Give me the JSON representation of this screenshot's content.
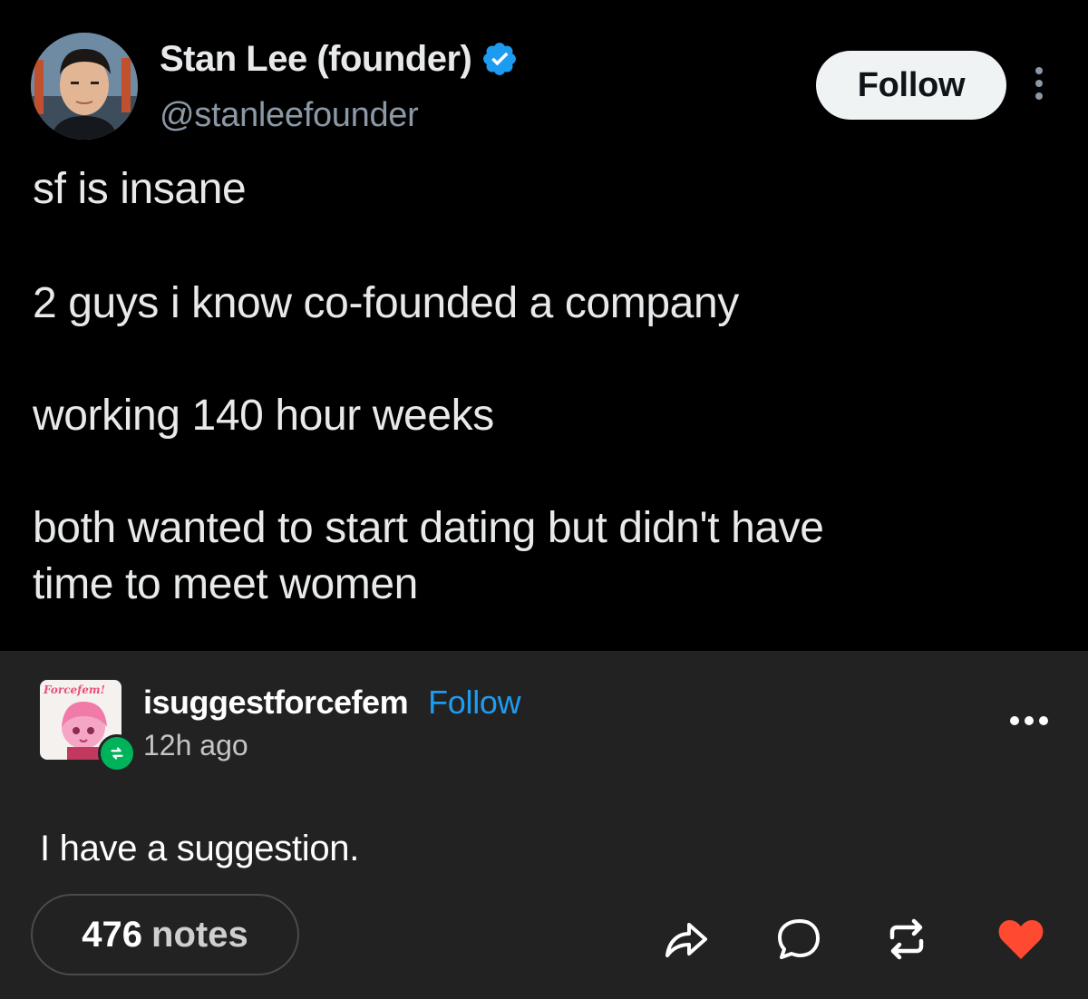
{
  "tweet": {
    "display_name": "Stan Lee (founder)",
    "handle": "@stanleefounder",
    "verified_icon": "verified-badge-icon",
    "follow_label": "Follow",
    "lines": [
      "sf is insane",
      "2 guys i know co-founded a company",
      "working 140 hour weeks",
      "both wanted to start dating but didn't have",
      "time to meet women"
    ],
    "accent_color": "#1d9bf0"
  },
  "reblog": {
    "username": "isuggestforcefem",
    "follow_label": "Follow",
    "timestamp": "12h ago",
    "avatar_logo_text": "Forcefem!",
    "body": "I have a suggestion.",
    "notes_count": "476",
    "notes_label": "notes",
    "actions": [
      "share-icon",
      "comment-icon",
      "reblog-icon",
      "like-icon"
    ],
    "like_color": "#ff4930",
    "follow_color": "#1e9cf0",
    "reblog_badge_color": "#00b25a"
  }
}
